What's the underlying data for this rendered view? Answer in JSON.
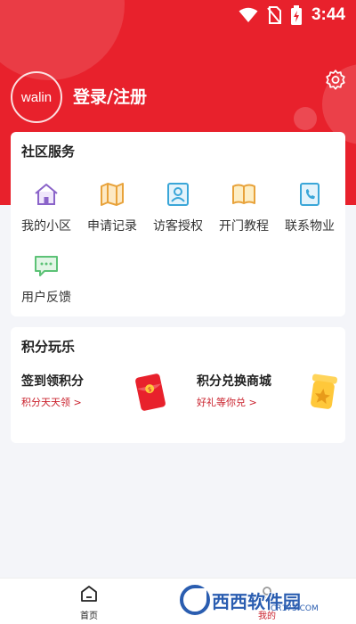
{
  "status_bar": {
    "time": "3:44"
  },
  "header": {
    "logo_text": "walin",
    "login_label": "登录/注册"
  },
  "community_services": {
    "title": "社区服务",
    "items": [
      {
        "label": "我的小区",
        "icon": "home-icon"
      },
      {
        "label": "申请记录",
        "icon": "map-icon"
      },
      {
        "label": "访客授权",
        "icon": "visitor-id-icon"
      },
      {
        "label": "开门教程",
        "icon": "book-icon"
      },
      {
        "label": "联系物业",
        "icon": "phone-book-icon"
      },
      {
        "label": "用户反馈",
        "icon": "chat-icon"
      }
    ]
  },
  "points": {
    "title": "积分玩乐",
    "items": [
      {
        "title": "签到领积分",
        "subtitle": "积分天天领 >",
        "icon": "red-envelope-icon"
      },
      {
        "title": "积分兑换商城",
        "subtitle": "好礼等你兑 >",
        "icon": "gift-box-icon"
      }
    ]
  },
  "tabbar": {
    "tabs": [
      {
        "label": "首页",
        "icon": "home-tab-icon"
      },
      {
        "label": "我的",
        "icon": "profile-tab-icon"
      }
    ]
  },
  "watermark": {
    "text": "西西软件园",
    "url": "CR173.COM"
  },
  "colors": {
    "brand_red": "#e8212c",
    "accent_red": "#c91f2a",
    "background": "#f4f5f9"
  }
}
